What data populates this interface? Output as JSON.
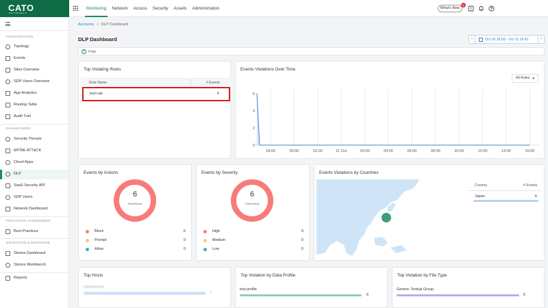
{
  "brand": {
    "name": "CATO",
    "tagline": "NETWORKS"
  },
  "topnav": {
    "items": [
      "Monitoring",
      "Network",
      "Access",
      "Security",
      "Assets",
      "Administration"
    ],
    "whats_new": "What's New",
    "whats_new_count": "6"
  },
  "sidebar": {
    "sections": {
      "investigation": "INVESTIGATION",
      "dashboards": "DASHBOARDS",
      "practices": "PRACTICES ASSESSMENT",
      "detection": "DETECTION & RESPONSE"
    },
    "items": {
      "topology": "Topology",
      "events": "Events",
      "sites_overview": "Sites Overview",
      "sdp_users_overview": "SDP Users Overview",
      "app_analytics": "App Analytics",
      "routing_table": "Routing Table",
      "audit_trail": "Audit Trail",
      "security_threats": "Security Threats",
      "mitre": "MITRE ATT&CK",
      "cloud_apps": "Cloud Apps",
      "dlp": "DLP",
      "saas_security": "SaaS Security API",
      "sdp_users": "SDP Users",
      "network_dashboard": "Network Dashboard",
      "best_practices": "Best Practices",
      "stories_dashboard": "Stories Dashboard",
      "stories_workbench": "Stories Workbench",
      "reports": "Reports"
    }
  },
  "breadcrumb": {
    "root": "Accounts",
    "sep": "/",
    "current": "DLP Dashboard"
  },
  "page_title": "DLP Dashboard",
  "date_range": "Oct 10 16:59 - Oct 11 16:41",
  "filter_label": "Filter",
  "top_rules": {
    "title": "Top Violating Rules",
    "col_name": "Rule Name",
    "col_events": "# Events",
    "rows": [
      {
        "name": "test rule",
        "events": "6"
      }
    ]
  },
  "events_over_time": {
    "title": "Events Violations Over Time",
    "select": "All Rules"
  },
  "chart_data": {
    "type": "line",
    "title": "Events Violations Over Time",
    "x": [
      "16:59",
      "17:10",
      "18:00",
      "20:00",
      "22:00",
      "11 Oct",
      "02:00",
      "04:00",
      "06:00",
      "08:00",
      "10:00",
      "12:00",
      "14:00",
      "16:00"
    ],
    "x_tick_labels": [
      "18:00",
      "20:00",
      "22:00",
      "11 Oct",
      "02:00",
      "04:00",
      "06:00",
      "08:00",
      "10:00",
      "12:00",
      "14:00",
      "16:00"
    ],
    "series": [
      {
        "values": [
          6,
          0,
          0,
          0,
          0,
          0,
          0,
          0,
          0,
          0,
          0,
          0,
          0,
          0
        ]
      }
    ],
    "y_ticks": [
      "0",
      "2",
      "4",
      "6"
    ],
    "ylim": [
      0,
      6.5
    ],
    "grid": "vertical",
    "color": "#4a7fd6"
  },
  "by_actions": {
    "title": "Events by Actions",
    "total": "6",
    "total_label": "Total Events",
    "legend": [
      {
        "label": "Block",
        "value": "6",
        "color": "#f87b7b"
      },
      {
        "label": "Prompt",
        "value": "0",
        "color": "#f8c28a"
      },
      {
        "label": "Allow",
        "value": "0",
        "color": "#3fb39a"
      }
    ]
  },
  "by_severity": {
    "title": "Events by Severity",
    "total": "6",
    "total_label": "Total Events",
    "legend": [
      {
        "label": "High",
        "value": "6",
        "color": "#f87b7b"
      },
      {
        "label": "Medium",
        "value": "0",
        "color": "#f8c28a"
      },
      {
        "label": "Low",
        "value": "0",
        "color": "#3fb39a"
      }
    ]
  },
  "by_countries": {
    "title": "Events Violations by Countries",
    "col_country": "Country",
    "col_events": "# Events",
    "rows": [
      {
        "country": "Japan",
        "events": "6"
      }
    ]
  },
  "top_hosts": {
    "title": "Top Hosts",
    "rows": [
      {
        "events": "6"
      }
    ]
  },
  "by_profile": {
    "title": "Top Violation by Data Profile",
    "rows": [
      {
        "name": "test profile",
        "events": "6"
      }
    ]
  },
  "by_file_type": {
    "title": "Top Violation by File Type",
    "rows": [
      {
        "name": "Generic Textual Group",
        "events": "6"
      }
    ]
  }
}
